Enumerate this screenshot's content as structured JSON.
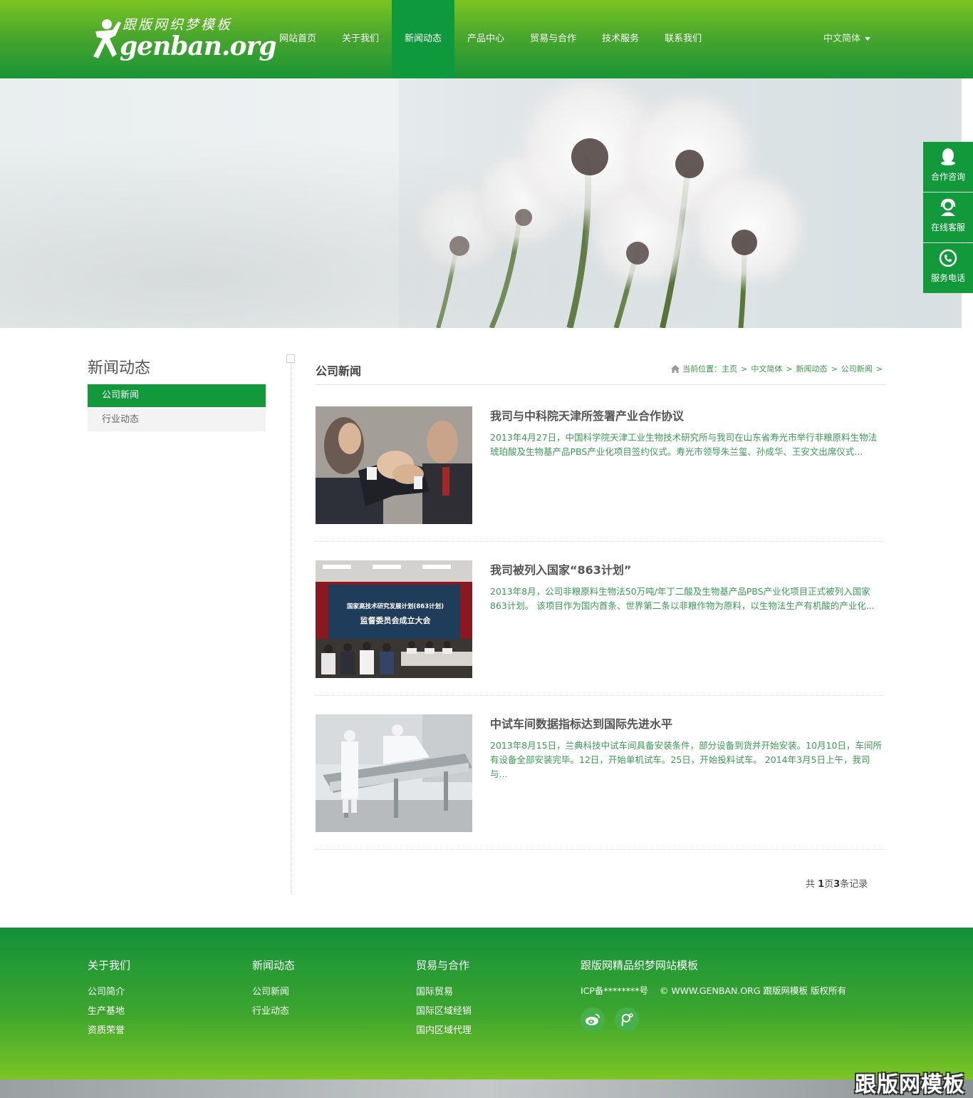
{
  "header": {
    "logo_tagline": "跟版网织梦模板",
    "logo_wordmark": "genban.org",
    "nav": [
      {
        "label": "网站首页"
      },
      {
        "label": "关于我们"
      },
      {
        "label": "新闻动态",
        "active": true
      },
      {
        "label": "产品中心"
      },
      {
        "label": "贸易与合作"
      },
      {
        "label": "技术服务"
      },
      {
        "label": "联系我们"
      }
    ],
    "language": "中文简体"
  },
  "float_bar": [
    {
      "label": "合作咨询",
      "icon": "qq-icon"
    },
    {
      "label": "在线客服",
      "icon": "headset-icon"
    },
    {
      "label": "服务电话",
      "icon": "phone-icon"
    }
  ],
  "sidebar": {
    "title": "新闻动态",
    "items": [
      {
        "label": "公司新闻",
        "active": true
      },
      {
        "label": "行业动态"
      }
    ]
  },
  "content": {
    "title": "公司新闻",
    "breadcrumb": {
      "prefix": "当前位置：",
      "items": [
        "主页",
        "中文简体",
        "新闻动态",
        "公司新闻"
      ],
      "separator": ">"
    },
    "news": [
      {
        "title": "我司与中科院天津所签署产业合作协议",
        "desc": "2013年4月27日，中国科学院天津工业生物技术研究所与我司在山东省寿光市举行非粮原料生物法琥珀酸及生物基产品PBS产业化项目签约仪式。寿光市领导朱兰玺、孙成华、王安文出席仪式...",
        "image": "handshake-photo"
      },
      {
        "title": "我司被列入国家“863计划”",
        "desc": "2013年8月，公司非粮原料生物法50万吨/年丁二酸及生物基产品PBS产业化项目正式被列入国家863计划。 该项目作为国内首条、世界第二条以非粮作物为原料，以生物法生产有机酸的产业化...",
        "image": "conference-photo",
        "screen_line1": "国家高技术研究发展计划(863计划)",
        "screen_line2": "监督委员会成立大会"
      },
      {
        "title": "中试车间数据指标达到国际先进水平",
        "desc": "2013年8月15日，兰典科技中试车间具备安装条件，部分设备到货并开始安装。10月10日，车间所有设备全部安装完毕。12日，开始单机试车。25日，开始投料试车。 2014年3月5日上午，我司与...",
        "image": "workshop-photo"
      }
    ],
    "pager": {
      "prefix": "共 ",
      "pages": "1",
      "mid": "页",
      "records": "3",
      "suffix": "条记录"
    }
  },
  "footer": {
    "columns": [
      {
        "title": "关于我们",
        "links": [
          "公司简介",
          "生产基地",
          "资质荣誉"
        ]
      },
      {
        "title": "新闻动态",
        "links": [
          "公司新闻",
          "行业动态"
        ]
      },
      {
        "title": "贸易与合作",
        "links": [
          "国际贸易",
          "国际区域经销",
          "国内区域代理"
        ]
      }
    ],
    "brand_title": "跟版网精品织梦网站模板",
    "copyright": "ICP备********号    © WWW.GENBAN.ORG 跟版网模板 版权所有",
    "social": [
      "weibo-icon",
      "tencent-weibo-icon"
    ]
  },
  "watermark": "跟版网模板",
  "colors": {
    "brand_green": "#11993b",
    "header_top": "#7cc522",
    "text_green": "#3a9a55"
  }
}
